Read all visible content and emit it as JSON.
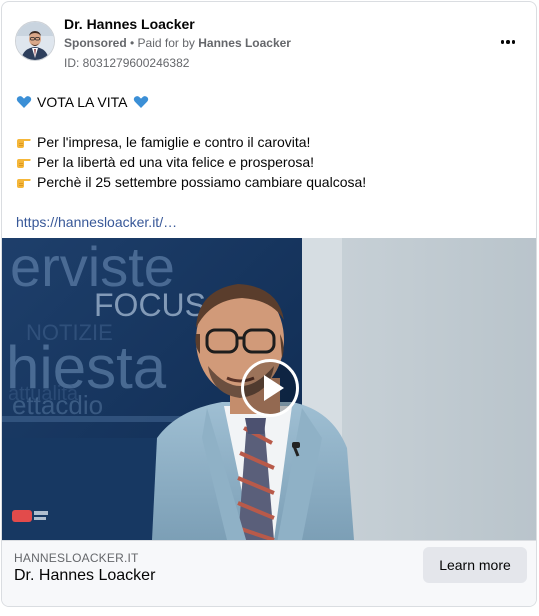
{
  "post": {
    "page_name": "Dr. Hannes Loacker",
    "sponsored": "Sponsored",
    "paid_for_prefix": "• Paid for by",
    "payer": "Hannes Loacker",
    "ad_id": "ID: 8031279600246382"
  },
  "body": {
    "headline": "VOTA LA VITA",
    "bullets": [
      "Per l'impresa, le famiglie e contro il carovita!",
      "Per la libertà ed una vita felice e prosperosa!",
      "Perchè il 25 settembre possiamo cambiare qualcosa!"
    ],
    "link": "https://hannesloacker.it/…"
  },
  "video": {
    "backdrop_words": [
      "erviste",
      "FOCUS",
      "NOTIZIE",
      "hiesta",
      "attualità",
      "ettacdio"
    ]
  },
  "footer": {
    "domain": "HANNESLOACKER.IT",
    "title": "Dr. Hannes Loacker",
    "cta_label": "Learn more"
  },
  "icons": {
    "heart": "blue-heart-icon",
    "pointing": "backhand-index-pointing-right-icon"
  },
  "colors": {
    "heart": "#3b8fd6",
    "link": "#385898",
    "cta_bg": "#e4e6eb"
  }
}
